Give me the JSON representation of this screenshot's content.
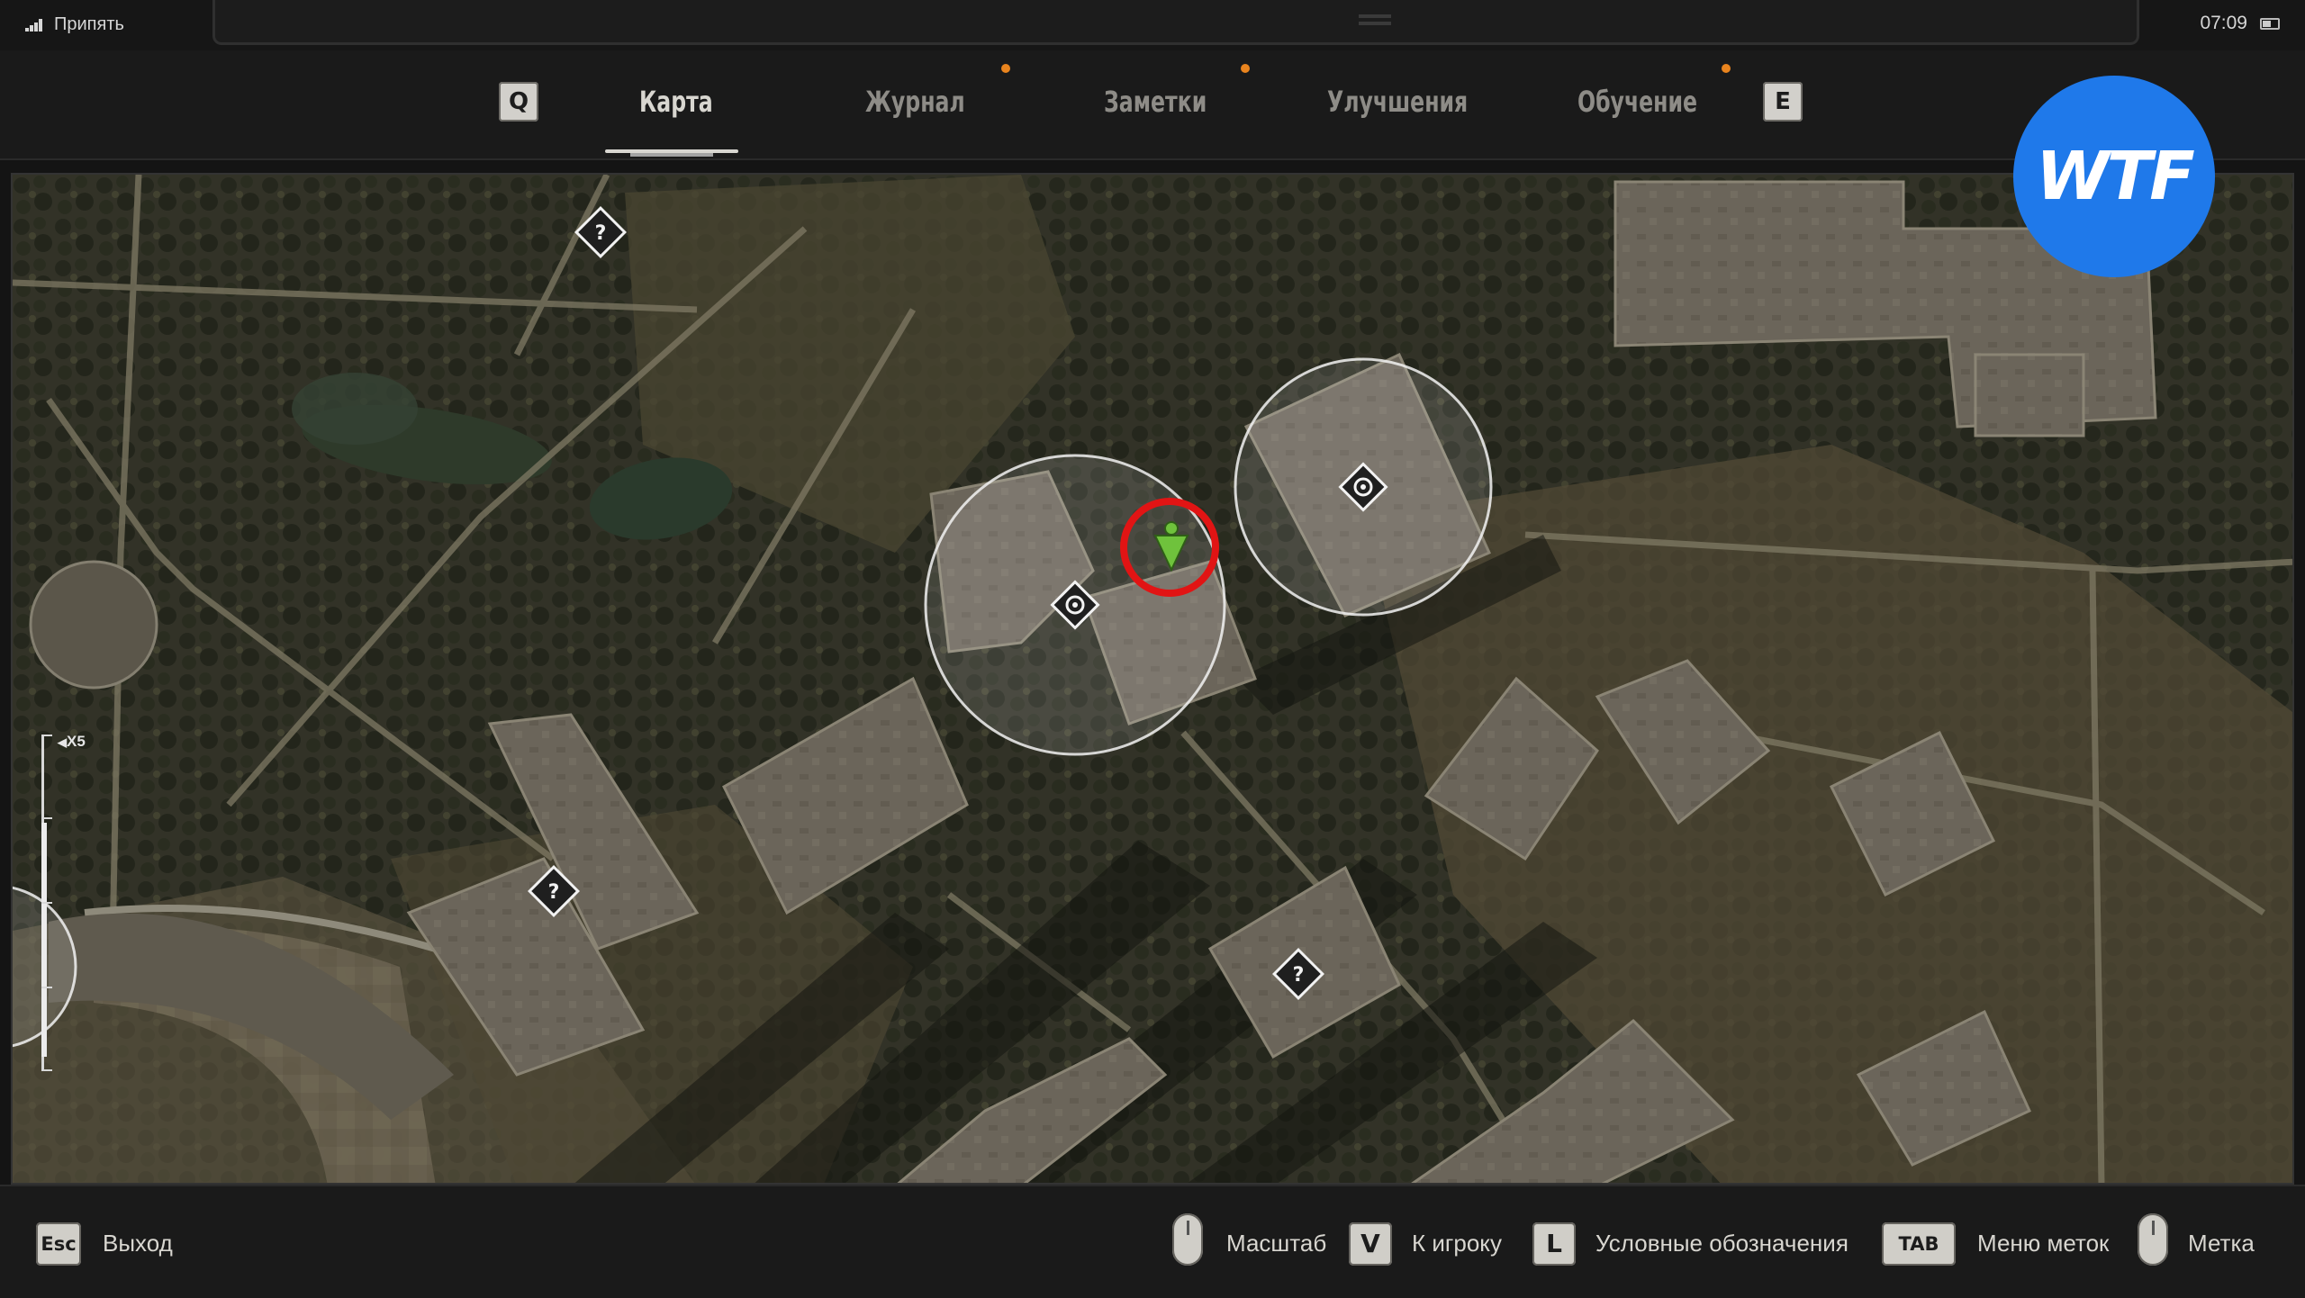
{
  "status": {
    "location": "Припять",
    "time": "07:09"
  },
  "nav": {
    "key_prev": "Q",
    "key_next": "E",
    "tabs": [
      {
        "label": "Карта",
        "active": true,
        "has_dot": false
      },
      {
        "label": "Журнал",
        "active": false,
        "has_dot": true
      },
      {
        "label": "Заметки",
        "active": false,
        "has_dot": true
      },
      {
        "label": "Улучшения",
        "active": false,
        "has_dot": false
      },
      {
        "label": "Обучение",
        "active": false,
        "has_dot": true
      }
    ],
    "notification_color": "#e9841e"
  },
  "map": {
    "zoom_label": "X5",
    "markers": {
      "unknown": "?",
      "quest_zone": "quest-zone-marker",
      "player": "player-arrow",
      "highlight": "red-circle-highlight"
    },
    "highlight_color": "#e11414",
    "player_color": "#6fc23c"
  },
  "watermark": {
    "text": "WTF",
    "color": "#1f79ea"
  },
  "controls": {
    "exit_key": "Esc",
    "exit_label": "Выход",
    "zoom_label": "Масштаб",
    "to_player_key": "V",
    "to_player_label": "К игроку",
    "legend_key": "L",
    "legend_label": "Условные обозначения",
    "marks_menu_key": "TAB",
    "marks_menu_label": "Меню меток",
    "mark_label": "Метка"
  }
}
